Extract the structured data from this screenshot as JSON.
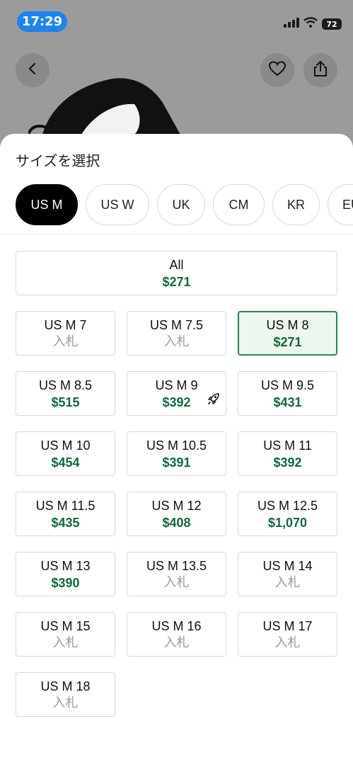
{
  "status_bar": {
    "time": "17:29",
    "battery": "72"
  },
  "sheet": {
    "title": "サイズを選択"
  },
  "tabs": [
    {
      "label": "US M",
      "active": true
    },
    {
      "label": "US W",
      "active": false
    },
    {
      "label": "UK",
      "active": false
    },
    {
      "label": "CM",
      "active": false
    },
    {
      "label": "KR",
      "active": false
    },
    {
      "label": "EU",
      "active": false
    }
  ],
  "all_option": {
    "label": "All",
    "price": "$271"
  },
  "sizes": [
    {
      "label": "US M 7",
      "value": "入札",
      "type": "bid"
    },
    {
      "label": "US M 7.5",
      "value": "入札",
      "type": "bid"
    },
    {
      "label": "US M 8",
      "value": "$271",
      "type": "price",
      "selected": true
    },
    {
      "label": "US M 8.5",
      "value": "$515",
      "type": "price"
    },
    {
      "label": "US M 9",
      "value": "$392",
      "type": "price",
      "icon": "rocket-icon"
    },
    {
      "label": "US M 9.5",
      "value": "$431",
      "type": "price"
    },
    {
      "label": "US M 10",
      "value": "$454",
      "type": "price"
    },
    {
      "label": "US M 10.5",
      "value": "$391",
      "type": "price"
    },
    {
      "label": "US M 11",
      "value": "$392",
      "type": "price"
    },
    {
      "label": "US M 11.5",
      "value": "$435",
      "type": "price"
    },
    {
      "label": "US M 12",
      "value": "$408",
      "type": "price"
    },
    {
      "label": "US M 12.5",
      "value": "$1,070",
      "type": "price"
    },
    {
      "label": "US M 13",
      "value": "$390",
      "type": "price"
    },
    {
      "label": "US M 13.5",
      "value": "入札",
      "type": "bid"
    },
    {
      "label": "US M 14",
      "value": "入札",
      "type": "bid"
    },
    {
      "label": "US M 15",
      "value": "入札",
      "type": "bid"
    },
    {
      "label": "US M 16",
      "value": "入札",
      "type": "bid"
    },
    {
      "label": "US M 17",
      "value": "入札",
      "type": "bid"
    },
    {
      "label": "US M 18",
      "value": "入札",
      "type": "bid"
    }
  ],
  "colors": {
    "price_green": "#0f6a3a",
    "selected_border": "#1e8a4d",
    "selected_bg": "#eef7ef",
    "time_pill": "#1a84f0"
  }
}
